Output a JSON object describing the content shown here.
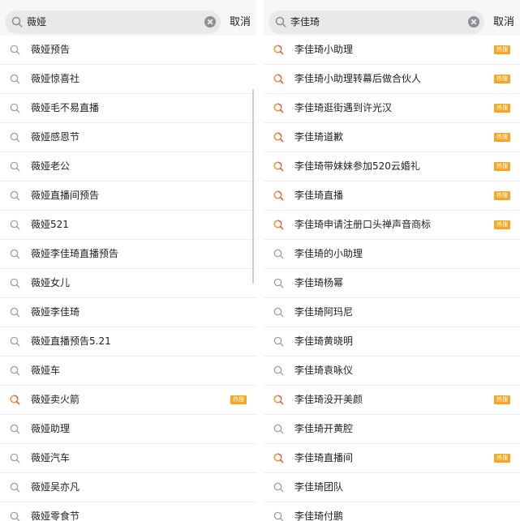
{
  "colors": {
    "hot_badge": "#f6a623",
    "hot_icon_orange": "#f08a24",
    "hot_icon_red": "#e84a3c",
    "search_field_bg": "#e9e9eb"
  },
  "left": {
    "query": "薇娅",
    "cancel": "取消",
    "items": [
      {
        "label": "薇娅预告",
        "hot": false,
        "badge": ""
      },
      {
        "label": "薇娅惊喜社",
        "hot": false,
        "badge": ""
      },
      {
        "label": "薇娅毛不易直播",
        "hot": false,
        "badge": ""
      },
      {
        "label": "薇娅感恩节",
        "hot": false,
        "badge": ""
      },
      {
        "label": "薇娅老公",
        "hot": false,
        "badge": ""
      },
      {
        "label": "薇娅直播间预告",
        "hot": false,
        "badge": ""
      },
      {
        "label": "薇娅521",
        "hot": false,
        "badge": ""
      },
      {
        "label": "薇娅李佳琦直播预告",
        "hot": false,
        "badge": ""
      },
      {
        "label": "薇娅女儿",
        "hot": false,
        "badge": ""
      },
      {
        "label": "薇娅李佳琦",
        "hot": false,
        "badge": ""
      },
      {
        "label": "薇娅直播预告5.21",
        "hot": false,
        "badge": ""
      },
      {
        "label": "薇娅车",
        "hot": false,
        "badge": ""
      },
      {
        "label": "薇娅卖火箭",
        "hot": true,
        "badge": "热搜"
      },
      {
        "label": "薇娅助理",
        "hot": false,
        "badge": ""
      },
      {
        "label": "薇娅汽车",
        "hot": false,
        "badge": ""
      },
      {
        "label": "薇娅吴亦凡",
        "hot": false,
        "badge": ""
      },
      {
        "label": "薇娅零食节",
        "hot": false,
        "badge": ""
      }
    ]
  },
  "right": {
    "query": "李佳琦",
    "cancel": "取消",
    "items": [
      {
        "label": "李佳琦小助理",
        "hot": true,
        "badge": "热搜"
      },
      {
        "label": "李佳琦小助理转幕后做合伙人",
        "hot": true,
        "badge": "热搜"
      },
      {
        "label": "李佳琦逛街遇到许光汉",
        "hot": true,
        "badge": "热搜"
      },
      {
        "label": "李佳琦道歉",
        "hot": true,
        "badge": "热搜"
      },
      {
        "label": "李佳琦带妹妹参加520云婚礼",
        "hot": true,
        "badge": "热搜"
      },
      {
        "label": "李佳琦直播",
        "hot": true,
        "badge": "热搜"
      },
      {
        "label": "李佳琦申请注册口头禅声音商标",
        "hot": true,
        "badge": "热搜"
      },
      {
        "label": "李佳琦的小助理",
        "hot": false,
        "badge": ""
      },
      {
        "label": "李佳琦杨幂",
        "hot": false,
        "badge": ""
      },
      {
        "label": "李佳琦阿玛尼",
        "hot": false,
        "badge": ""
      },
      {
        "label": "李佳琦黄晓明",
        "hot": false,
        "badge": ""
      },
      {
        "label": "李佳琦袁咏仪",
        "hot": false,
        "badge": ""
      },
      {
        "label": "李佳琦没开美颜",
        "hot": true,
        "badge": "热搜"
      },
      {
        "label": "李佳琦开黄腔",
        "hot": false,
        "badge": ""
      },
      {
        "label": "李佳琦直播间",
        "hot": true,
        "badge": "热搜"
      },
      {
        "label": "李佳琦团队",
        "hot": false,
        "badge": ""
      },
      {
        "label": "李佳琦付鹏",
        "hot": false,
        "badge": ""
      }
    ]
  }
}
